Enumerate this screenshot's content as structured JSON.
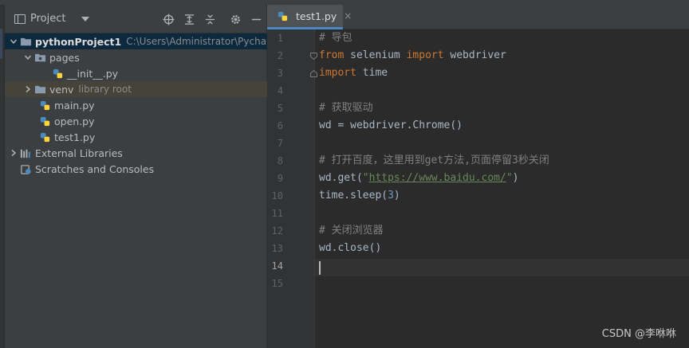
{
  "project_panel": {
    "title": "Project",
    "icons": [
      "locate-icon",
      "expand-all-icon",
      "collapse-all-icon",
      "gear-icon",
      "minimize-icon"
    ],
    "tree": [
      {
        "label": "pythonProject1",
        "hint": "C:\\Users\\Administrator\\Pycharm",
        "type": "root-folder"
      },
      {
        "label": "pages",
        "type": "folder"
      },
      {
        "label": "__init__.py",
        "type": "python-file"
      },
      {
        "label": "venv",
        "hint": "library root",
        "type": "folder"
      },
      {
        "label": "main.py",
        "type": "python-file"
      },
      {
        "label": "open.py",
        "type": "python-file"
      },
      {
        "label": "test1.py",
        "type": "python-file"
      },
      {
        "label": "External Libraries",
        "type": "libraries"
      },
      {
        "label": "Scratches and Consoles",
        "type": "scratches"
      }
    ]
  },
  "editor": {
    "tab": {
      "label": "test1.py",
      "close": "×"
    },
    "line_numbers": [
      "1",
      "2",
      "3",
      "4",
      "5",
      "6",
      "7",
      "8",
      "9",
      "10",
      "11",
      "12",
      "13",
      "14",
      "15"
    ],
    "current_line": 14,
    "code": {
      "l1": "# 导包",
      "l2_kw1": "from",
      "l2_mod": " selenium ",
      "l2_kw2": "import",
      "l2_name": " webdriver",
      "l3_kw": "import",
      "l3_name": " time",
      "l5": "# 获取驱动",
      "l6": "wd = webdriver.Chrome()",
      "l8": "# 打开百度，这里用到get方法,页面停留3秒关闭",
      "l9_pre": "wd.get(",
      "l9_q1": "\"",
      "l9_url": "https://www.baidu.com/",
      "l9_q2": "\"",
      "l9_post": ")",
      "l10_pre": "time.sleep(",
      "l10_num": "3",
      "l10_post": ")",
      "l12": "# 关闭浏览器",
      "l13": "wd.close()"
    }
  },
  "watermark": "CSDN @李咻咻",
  "colors": {
    "keyword": "#cc7832",
    "string": "#6a8759",
    "number": "#6897bb",
    "comment": "#808080",
    "selection": "#0d293e",
    "tab_underline": "#4a88c7"
  }
}
